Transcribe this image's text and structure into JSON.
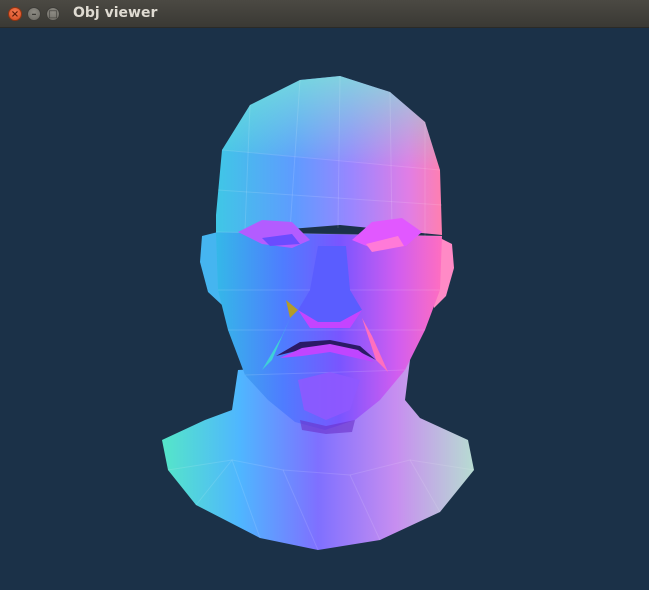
{
  "window": {
    "title": "Obj viewer",
    "close_glyph": "×",
    "minimize_glyph": "–",
    "maximize_glyph": "□"
  },
  "viewport": {
    "background_color": "#1b3148",
    "model_shading": "normal-map colors (cyan, blue, violet, magenta, pink)"
  }
}
